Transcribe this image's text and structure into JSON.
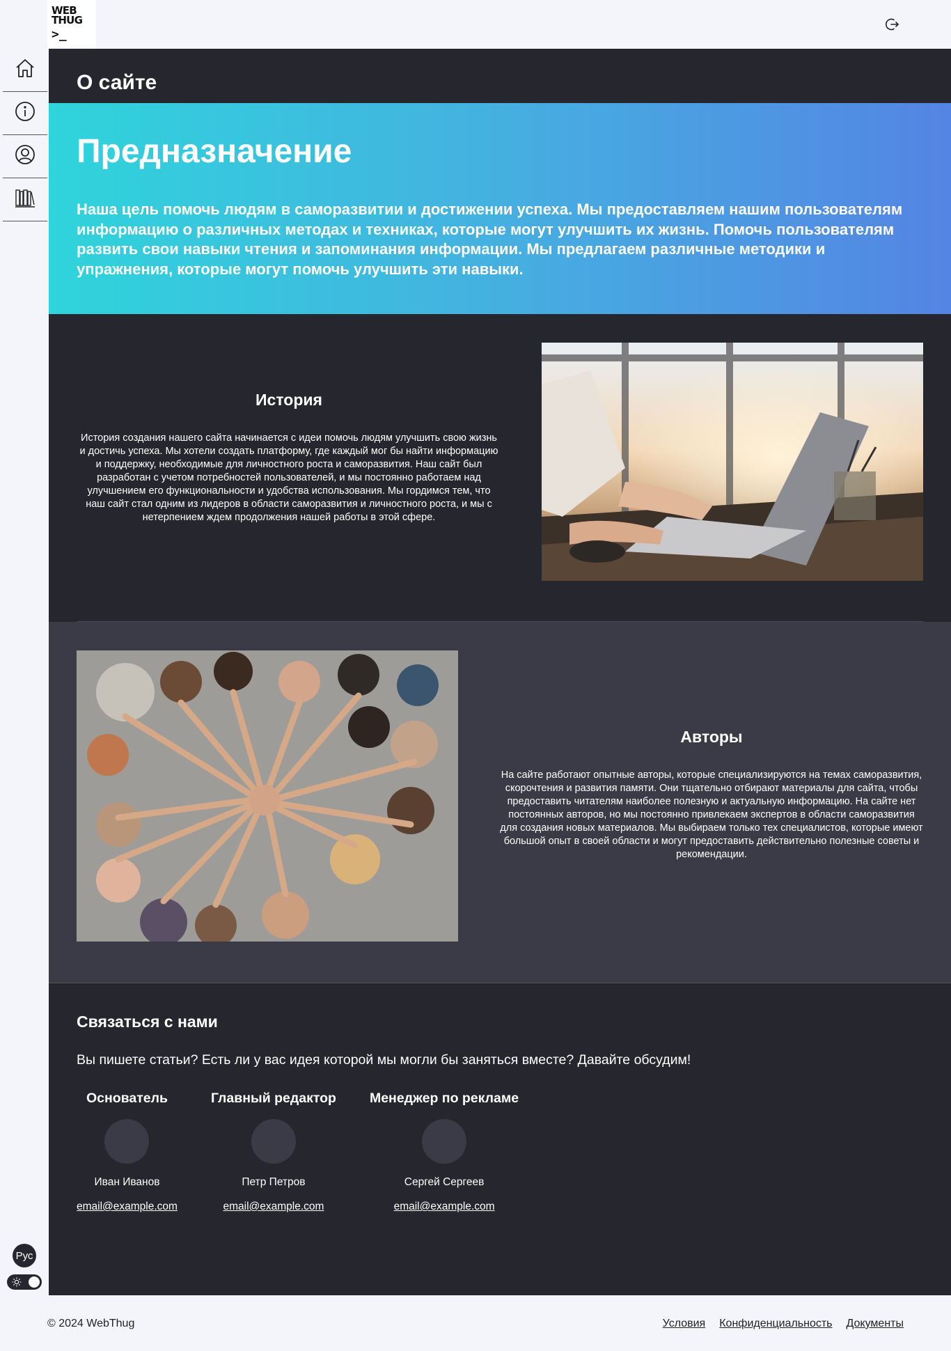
{
  "logo": {
    "line1": "WEB",
    "line2": "THUG",
    "prompt": ">_"
  },
  "header": {
    "logout_icon": "logout-icon"
  },
  "sidebar": {
    "items": [
      {
        "name": "home",
        "icon": "home-icon"
      },
      {
        "name": "about",
        "icon": "info-icon"
      },
      {
        "name": "profile",
        "icon": "user-icon"
      },
      {
        "name": "library",
        "icon": "books-icon"
      }
    ],
    "language_label": "Рус",
    "terminal_label": ">"
  },
  "page": {
    "title": "О сайте"
  },
  "hero": {
    "title": "Предназначение",
    "text": "Наша цель помочь людям в саморазвитии и достижении успеха. Мы предоставляем нашим пользователям информацию о различных методах и техниках, которые могут улучшить их жизнь. Помочь пользователям развить свои навыки чтения и запоминания информации. Мы предлагаем различные методики и упражнения, которые могут помочь улучшить эти навыки."
  },
  "history": {
    "title": "История",
    "text": "История создания нашего сайта начинается с идеи помочь людям улучшить свою жизнь и достичь успеха. Мы хотели создать платформу, где каждый мог бы найти информацию и поддержку, необходимые для личностного роста и саморазвития. Наш сайт был разработан с учетом потребностей пользователей, и мы постоянно работаем над улучшением его функциональности и удобства использования. Мы гордимся тем, что наш сайт стал одним из лидеров в области саморазвития и личностного роста, и мы с нетерпением ждем продолжения нашей работы в этой сфере."
  },
  "authors": {
    "title": "Авторы",
    "text": "На сайте работают опытные авторы, которые специализируются на темах саморазвития, скорочтения и развития памяти. Они тщательно отбирают материалы для сайта, чтобы предоставить читателям наиболее полезную и актуальную информацию. На сайте нет постоянных авторов, но мы постоянно привлекаем экспертов в области саморазвития для создания новых материалов. Мы выбираем только тех специалистов, которые имеют большой опыт в своей области и могут предоставить действительно полезные советы и рекомендации."
  },
  "contact": {
    "title": "Связаться с нами",
    "intro": "Вы пишете статьи? Есть ли у вас идея которой мы могли бы заняться вместе? Давайте обсудим!",
    "members": [
      {
        "role": "Основатель",
        "name": "Иван Иванов",
        "email": "email@example.com"
      },
      {
        "role": "Главный редактор",
        "name": "Петр Петров",
        "email": "email@example.com"
      },
      {
        "role": "Менеджер по рекламе",
        "name": "Сергей Сергеев",
        "email": "email@example.com"
      }
    ]
  },
  "footer": {
    "copyright": "© 2024 WebThug",
    "links": [
      "Условия",
      "Конфиденциальность",
      "Документы"
    ]
  }
}
